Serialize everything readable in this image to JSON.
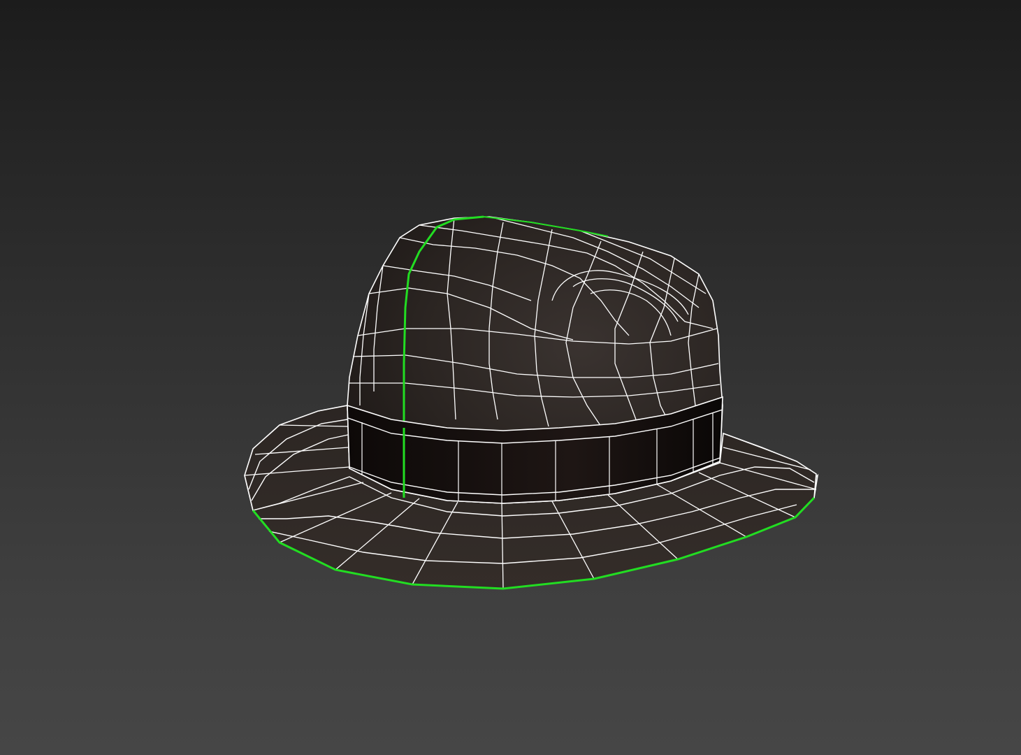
{
  "viewport": {
    "background_top": "#1c1c1c",
    "background_bottom": "#464646"
  },
  "model": {
    "object": "fedora-hat-icon",
    "mesh_fill": "#2b2522",
    "band_fill": "#110c0a",
    "wire_color": "#ffffff",
    "selected_edge_color": "#22dd22",
    "display_mode": "wireframe-on-shaded"
  }
}
